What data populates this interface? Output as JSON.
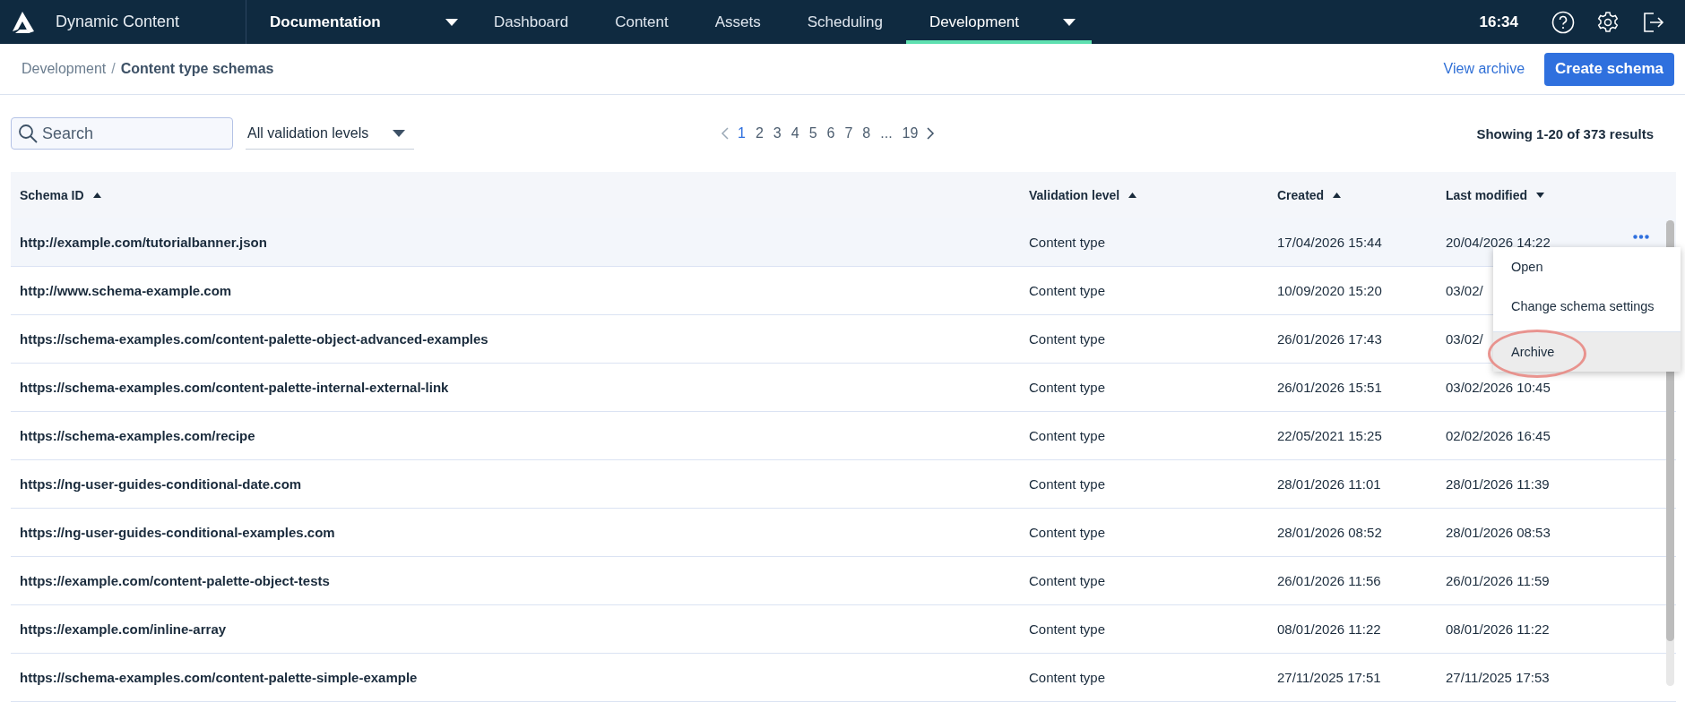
{
  "app_name": "Dynamic Content",
  "hub": {
    "label": "Documentation"
  },
  "nav": [
    {
      "label": "Dashboard",
      "selected": false,
      "has_menu": false
    },
    {
      "label": "Content",
      "selected": false,
      "has_menu": false
    },
    {
      "label": "Assets",
      "selected": false,
      "has_menu": false
    },
    {
      "label": "Scheduling",
      "selected": false,
      "has_menu": false
    },
    {
      "label": "Development",
      "selected": true,
      "has_menu": true
    }
  ],
  "clock": "16:34",
  "breadcrumb": [
    "Development",
    "Content type schemas"
  ],
  "breadcrumb_separator": "/",
  "actions": {
    "link": "View archive",
    "primary": "Create schema"
  },
  "search": {
    "placeholder": "Search"
  },
  "filter": {
    "value": "All validation levels"
  },
  "pagination": {
    "pages": [
      {
        "label": "1",
        "selected": true
      },
      {
        "label": "2",
        "selected": false
      },
      {
        "label": "3",
        "selected": false
      },
      {
        "label": "4",
        "selected": false
      },
      {
        "label": "5",
        "selected": false
      },
      {
        "label": "6",
        "selected": false
      },
      {
        "label": "7",
        "selected": false
      },
      {
        "label": "8",
        "selected": false
      },
      {
        "label": "...",
        "selected": false
      },
      {
        "label": "19",
        "selected": false
      }
    ]
  },
  "results": "Showing 1-20 of 373 results",
  "table": {
    "columns": [
      {
        "label": "Schema ID",
        "descending": false
      },
      {
        "label": "Validation level",
        "descending": false
      },
      {
        "label": "Created",
        "descending": false
      },
      {
        "label": "Last modified",
        "descending": true
      }
    ],
    "rows": [
      {
        "cells": [
          "http://example.com/tutorialbanner.json",
          "Content type",
          "17/04/2026 15:44",
          "20/04/2026 14:22"
        ],
        "selected": true
      },
      {
        "cells": [
          "http://www.schema-example.com",
          "Content type",
          "10/09/2020 15:20",
          "03/02/"
        ],
        "selected": false
      },
      {
        "cells": [
          "https://schema-examples.com/content-palette-object-advanced-examples",
          "Content type",
          "26/01/2026 17:43",
          "03/02/"
        ],
        "selected": false
      },
      {
        "cells": [
          "https://schema-examples.com/content-palette-internal-external-link",
          "Content type",
          "26/01/2026 15:51",
          "03/02/2026 10:45"
        ],
        "selected": false
      },
      {
        "cells": [
          "https://schema-examples.com/recipe",
          "Content type",
          "22/05/2021 15:25",
          "02/02/2026 16:45"
        ],
        "selected": false
      },
      {
        "cells": [
          "https://ng-user-guides-conditional-date.com",
          "Content type",
          "28/01/2026 11:01",
          "28/01/2026 11:39"
        ],
        "selected": false
      },
      {
        "cells": [
          "https://ng-user-guides-conditional-examples.com",
          "Content type",
          "28/01/2026 08:52",
          "28/01/2026 08:53"
        ],
        "selected": false
      },
      {
        "cells": [
          "https://example.com/content-palette-object-tests",
          "Content type",
          "26/01/2026 11:56",
          "26/01/2026 11:59"
        ],
        "selected": false
      },
      {
        "cells": [
          "https://example.com/inline-array",
          "Content type",
          "08/01/2026 11:22",
          "08/01/2026 11:22"
        ],
        "selected": false
      },
      {
        "cells": [
          "https://schema-examples.com/content-palette-simple-example",
          "Content type",
          "27/11/2025 17:51",
          "27/11/2025 17:53"
        ],
        "selected": false
      }
    ]
  },
  "row_menu": {
    "items": [
      {
        "label": "Open",
        "highlighted": false,
        "divider_before": false
      },
      {
        "label": "Change schema settings",
        "highlighted": false,
        "divider_before": false
      },
      {
        "label": "Archive",
        "highlighted": true,
        "divider_before": true
      }
    ]
  }
}
